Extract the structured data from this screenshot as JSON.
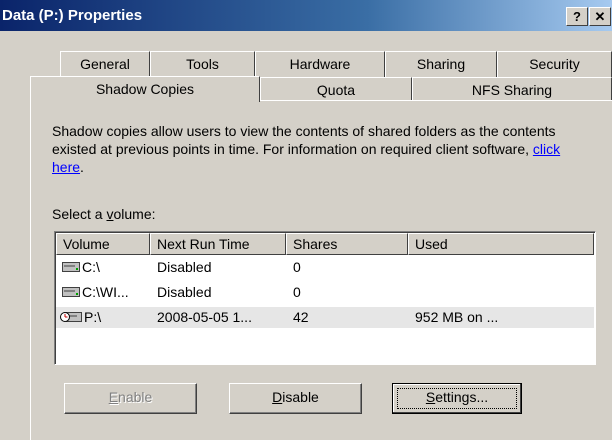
{
  "window": {
    "title": "Data (P:) Properties",
    "help_glyph": "?",
    "close_glyph": "✕"
  },
  "tabs": {
    "row1": [
      "General",
      "Tools",
      "Hardware",
      "Sharing",
      "Security"
    ],
    "row2": [
      "Shadow Copies",
      "Quota",
      "NFS Sharing"
    ],
    "active": "Shadow Copies"
  },
  "shadow_copies": {
    "description": "Shadow copies allow users to view the contents of shared folders as the contents existed at previous points in time. For information on required client software,",
    "link_text": "click here",
    "after_link": ".",
    "select_label_prefix": "Select a ",
    "select_label_underlined": "v",
    "select_label_suffix": "olume:",
    "columns": [
      "Volume",
      "Next Run Time",
      "Shares",
      "Used"
    ],
    "rows": [
      {
        "icon": "drive-icon",
        "volume": "C:\\",
        "next_run": "Disabled",
        "shares": "0",
        "used": ""
      },
      {
        "icon": "drive-icon",
        "volume": "C:\\WI...",
        "next_run": "Disabled",
        "shares": "0",
        "used": ""
      },
      {
        "icon": "scheduled-drive-icon",
        "volume": "P:\\",
        "next_run": "2008-05-05 1...",
        "shares": "42",
        "used": "952 MB on ..."
      }
    ],
    "buttons": {
      "enable": {
        "underlined": "E",
        "rest": "nable"
      },
      "disable": {
        "underlined": "D",
        "rest": "isable"
      },
      "settings": {
        "underlined": "S",
        "rest": "ettings..."
      }
    }
  }
}
